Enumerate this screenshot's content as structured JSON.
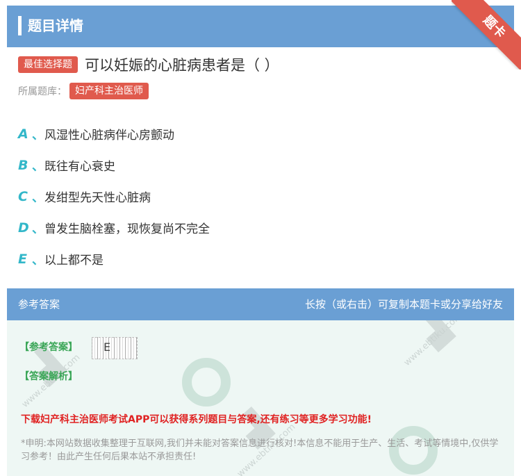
{
  "header": {
    "title": "题目详情",
    "corner_badge": "题卡"
  },
  "question": {
    "type_badge": "最佳选择题",
    "text": "可以妊娠的心脏病患者是（ ）",
    "source_label": "所属题库：",
    "source_value": "妇产科主治医师"
  },
  "options": [
    {
      "letter": "A",
      "sep": "、",
      "text": "风湿性心脏病伴心房颤动"
    },
    {
      "letter": "B",
      "sep": "、",
      "text": "既往有心衰史"
    },
    {
      "letter": "C",
      "sep": "、",
      "text": "发绀型先天性心脏病"
    },
    {
      "letter": "D",
      "sep": "、",
      "text": "曾发生脑栓塞，现恢复尚不完全"
    },
    {
      "letter": "E",
      "sep": "、",
      "text": "以上都不是"
    }
  ],
  "answer_section": {
    "title": "参考答案",
    "hint": "长按（或右击）可复制本题卡或分享给好友",
    "answer_label": "【参考答案】",
    "answer_value": "E",
    "analysis_label": "【答案解析】",
    "promo": "下载妇产科主治医师考试APP可以获得系列题目与答案,还有练习等更多学习功能!",
    "disclaimer": "*申明:本网站数据收集整理于互联网,我们并未能对答案信息进行核对!本信息不能用于生产、生活、考试等情境中,仅供学习参考！由此产生任何后果本站不承担责任!"
  },
  "colors": {
    "header_blue": "#6a9fd4",
    "badge_red": "#e05a4d",
    "option_teal": "#33b7c9",
    "answer_green": "#3aa657",
    "promo_red": "#e02222",
    "answer_bg": "#eef7f4"
  }
}
